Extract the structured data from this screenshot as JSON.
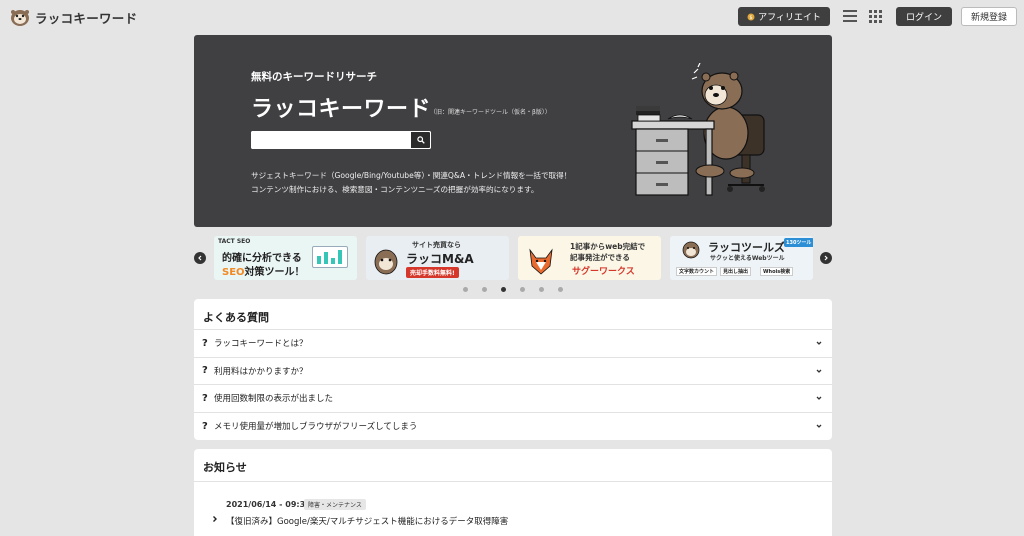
{
  "header": {
    "logo_text": "ラッコキーワード",
    "affiliate_label": "アフィリエイト",
    "login_label": "ログイン",
    "signup_label": "新規登録"
  },
  "hero": {
    "subtitle": "無料のキーワードリサーチ",
    "title": "ラッコキーワード",
    "title_note": "（旧：関連キーワードツール（仮名・β版））",
    "search_value": "",
    "search_placeholder": "",
    "desc_line1": "サジェストキーワード（Google/Bing/Youtube等）・関連Q&A・トレンド情報を一括で取得！",
    "desc_line2": "コンテンツ制作における、検索意図・コンテンツニーズの把握が効率的になります。"
  },
  "carousel": {
    "banners": [
      {
        "brand": "TACT SEO",
        "line1": "的確に分析できる",
        "line2a": "SEO",
        "line2b": "対策ツール！"
      },
      {
        "line1": "サイト売買なら",
        "line2": "ラッコM&A",
        "line3": "売却手数料無料!"
      },
      {
        "line1": "1記事からweb完結で",
        "line2": "記事発注ができる",
        "line3": "サグーワークス"
      },
      {
        "line1": "ラッコツールズ",
        "line2": "サクッと使えるWebツール",
        "badge": "130ツール 無料!",
        "tag1": "文字数カウント",
        "tag2": "見出し抽出",
        "tag3": "Whois検索"
      }
    ],
    "dots": [
      false,
      false,
      true,
      false,
      false,
      false
    ]
  },
  "faq": {
    "title": "よくある質問",
    "items": [
      {
        "q": "?",
        "text": "ラッコキーワードとは？"
      },
      {
        "q": "?",
        "text": "利用料はかかりますか？"
      },
      {
        "q": "?",
        "text": "使用回数制限の表示が出ました"
      },
      {
        "q": "?",
        "text": "メモリ使用量が増加しブラウザがフリーズしてしまう"
      }
    ]
  },
  "news": {
    "title": "お知らせ",
    "items": [
      {
        "date": "2021/06/14 - 09:30",
        "tag": "障害・メンテナンス",
        "title": "【復旧済み】Google/楽天/マルチサジェスト機能におけるデータ取得障害"
      }
    ]
  },
  "colors": {
    "hero_bg": "#404043",
    "page_bg": "#e5e5e5",
    "dark_button": "#3f3f3f",
    "seo_orange": "#f08a24",
    "sagoo_red": "#d6372b"
  },
  "icons": [
    "sea-otter-logo-icon",
    "coin-icon",
    "menu-icon",
    "apps-grid-icon",
    "search-icon",
    "chevron-left-icon",
    "chevron-right-icon",
    "chevron-down-icon",
    "question-icon"
  ]
}
